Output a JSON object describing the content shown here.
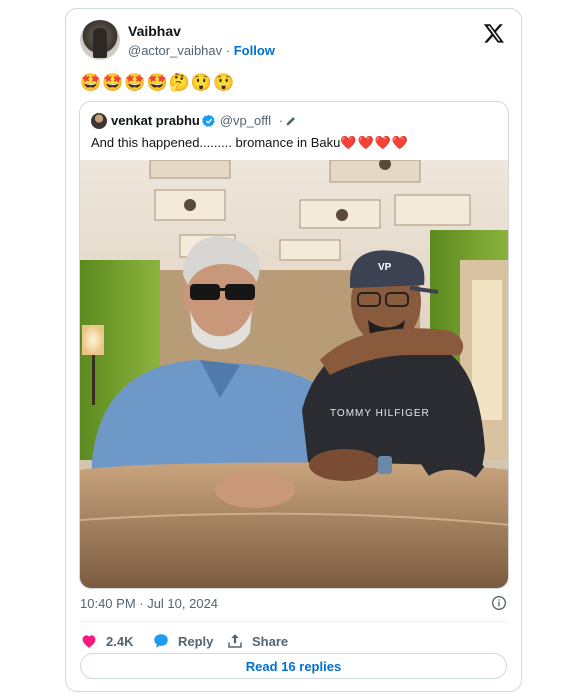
{
  "author": {
    "name": "Vaibhav",
    "handle": "@actor_vaibhav",
    "separator": "·",
    "follow_label": "Follow"
  },
  "tweet_text": "🤩🤩🤩🤩🤔😲😲",
  "quoted": {
    "name": "venkat prabhu",
    "handle": "@vp_offl",
    "separator": "·",
    "text": "And this happened......... bromance in Baku",
    "hearts": "❤️❤️❤️❤️",
    "verified_color": "#1d9bf0"
  },
  "timestamp": "10:40 PM · Jul 10, 2024",
  "actions": {
    "like_count": "2.4K",
    "reply_label": "Reply",
    "share_label": "Share",
    "like_color": "#f91880",
    "reply_color": "#1d9bf0"
  },
  "read_replies_label": "Read 16 replies",
  "colors": {
    "link": "#006fd6",
    "muted": "#536471",
    "border": "#cfd9de"
  }
}
